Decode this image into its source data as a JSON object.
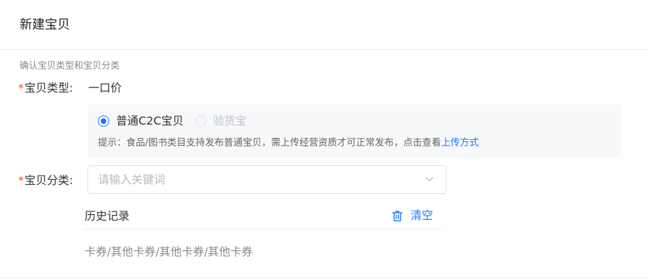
{
  "page": {
    "title": "新建宝贝"
  },
  "form": {
    "section_hint": "确认宝贝类型和宝贝分类",
    "required_mark": "*",
    "item_type": {
      "label": "宝贝类型:",
      "value": "一口价",
      "options": [
        {
          "label": "普通C2C宝贝",
          "checked": true,
          "disabled": false
        },
        {
          "label": "验货宝",
          "checked": false,
          "disabled": true
        }
      ],
      "tip_text": "提示：食品/图书类目支持发布普通宝贝，需上传经营资质才可正常发布，点击查看",
      "tip_link": "上传方式"
    },
    "category": {
      "label": "宝贝分类:",
      "placeholder": "请输入关键词",
      "value": ""
    }
  },
  "history": {
    "title": "历史记录",
    "clear_label": "清空",
    "items": [
      "卡券/其他卡券/其他卡券/其他卡券"
    ]
  },
  "colors": {
    "accent": "#1a78ff",
    "required": "#ff5000"
  },
  "icons": {
    "select_arrow": "chevron-down-icon",
    "clear": "trash-icon"
  }
}
